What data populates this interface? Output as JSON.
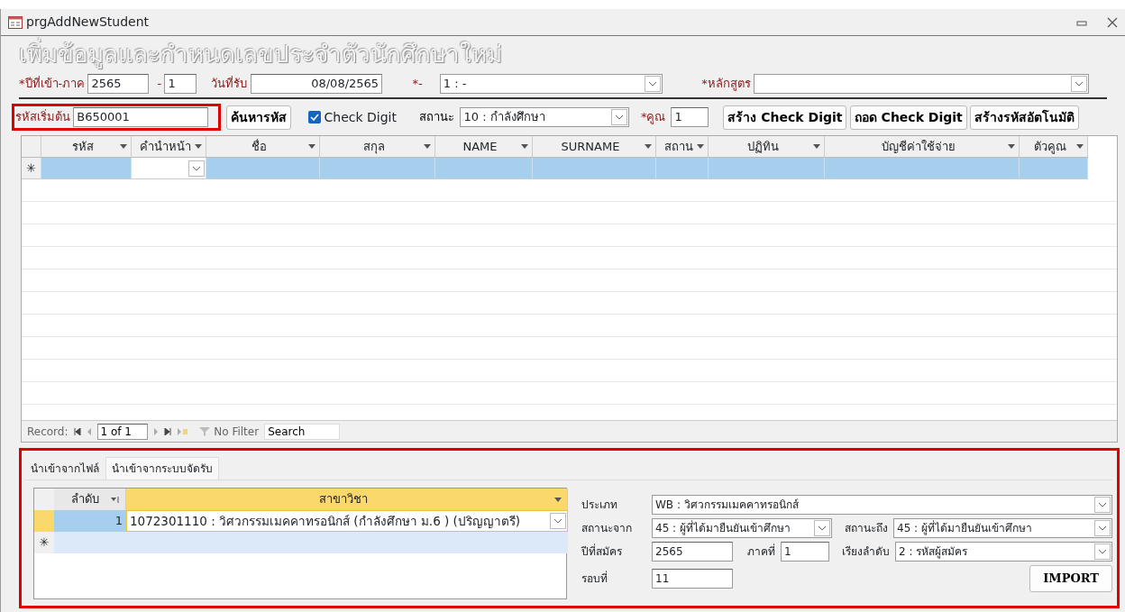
{
  "window": {
    "title": "prgAddNewStudent"
  },
  "heading": "เพิ่มข้อมูลและกำหนดเลขประจำตัวนักศึกษาใหม่",
  "row1": {
    "year_label": "*ปีที่เข้า-ภาค",
    "year": "2565",
    "dash": "-",
    "term": "1",
    "date_label": "วันที่รับ",
    "date": "08/08/2565",
    "round_label": "*-",
    "round": "1 : -",
    "curriculum_label": "*หลักสูตร"
  },
  "row2": {
    "start_code": {
      "label": "รหัสเริ่มต้น",
      "value": "B650001",
      "highlighted": true
    },
    "search_button": "ค้นหารหัส",
    "check_digit": {
      "label": "Check Digit",
      "checked": true
    },
    "status_label": "สถานะ",
    "status": "10 : กำลังศึกษา",
    "multiplier_label": "*คูณ",
    "multiplier": "1",
    "buttons": [
      "สร้าง Check Digit",
      "ถอด Check Digit",
      "สร้างรหัสอัตโนมัติ"
    ]
  },
  "grid": {
    "columns": [
      {
        "label": "รหัส"
      },
      {
        "label": "คำนำหน้า"
      },
      {
        "label": "ชื่อ"
      },
      {
        "label": "สกุล"
      },
      {
        "label": "NAME"
      },
      {
        "label": "SURNAME"
      },
      {
        "label": "สถาน"
      },
      {
        "label": "ปฏิทิน"
      },
      {
        "label": "บัญชีค่าใช้จ่าย"
      },
      {
        "label": "ตัวคูณ"
      }
    ],
    "new_row_marker": "✳"
  },
  "record_nav": {
    "label": "Record:",
    "position": "1 of 1",
    "filter": "No Filter",
    "search": "Search"
  },
  "import": {
    "highlighted": true,
    "tabs": [
      {
        "label": "นำเข้าจากไฟล์",
        "selected": false
      },
      {
        "label": "นำเข้าจากระบบจัดรับ",
        "selected": true
      }
    ],
    "grid": {
      "columns": [
        {
          "label": "ลำดับ"
        },
        {
          "label": "สาขาวิชา"
        }
      ],
      "rows": [
        {
          "no": "1",
          "major": "1072301110 : วิศวกรรมเมคคาทรอนิกส์  (กำลังศึกษา ม.6 )  (ปริญญาตรี)"
        }
      ],
      "new_row_marker": "✳"
    },
    "form": {
      "type_label": "ประเภท",
      "type": "WB : วิศวกรรมเมคคาทรอนิกส์",
      "from_label": "สถานะจาก",
      "from": "45 : ผู้ที่ได้มายืนยันเข้าศึกษา",
      "to_label": "สถานะถึง",
      "to": "45 : ผู้ที่ได้มายืนยันเข้าศึกษา",
      "year_label": "ปีที่สมัคร",
      "year": "2565",
      "term_label": "ภาคที่",
      "term": "1",
      "order_label": "เรียงลำดับ",
      "order": "2 : รหัสผู้สมัคร",
      "round_label": "รอบที่",
      "round": "11"
    },
    "import_button": "IMPORT"
  }
}
